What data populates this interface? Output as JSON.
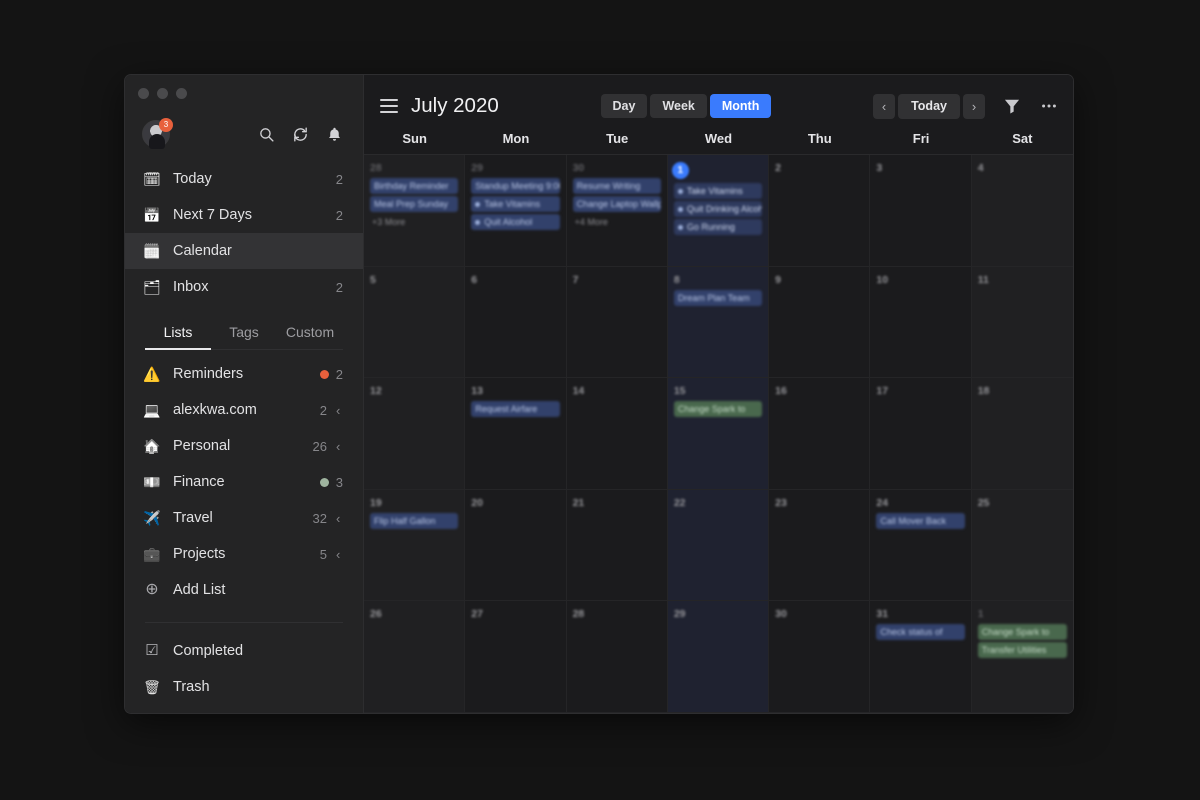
{
  "window": {
    "traffic_lights": [
      "close",
      "minimize",
      "zoom"
    ]
  },
  "sidebar": {
    "avatar_badge": "3",
    "header_icons": [
      "search-icon",
      "sync-icon",
      "bell-icon"
    ],
    "nav": [
      {
        "icon": "calendar-day",
        "label": "Today",
        "count": "2"
      },
      {
        "icon": "calendar-week",
        "label": "Next 7 Days",
        "count": "2"
      },
      {
        "icon": "calendar",
        "label": "Calendar",
        "count": "",
        "active": true
      },
      {
        "icon": "inbox",
        "label": "Inbox",
        "count": "2"
      }
    ],
    "tabs": [
      {
        "label": "Lists",
        "active": true
      },
      {
        "label": "Tags",
        "active": false
      },
      {
        "label": "Custom",
        "active": false
      }
    ],
    "lists": [
      {
        "icon": "⚠️",
        "label": "Reminders",
        "count": "2",
        "dot": "#e8603c",
        "chevron": ""
      },
      {
        "icon": "💻",
        "label": "alexkwa.com",
        "count": "2",
        "dot": "",
        "chevron": "‹"
      },
      {
        "icon": "🏠",
        "label": "Personal",
        "count": "26",
        "dot": "",
        "chevron": "‹"
      },
      {
        "icon": "💵",
        "label": "Finance",
        "count": "3",
        "dot": "#9fb49f",
        "chevron": ""
      },
      {
        "icon": "✈️",
        "label": "Travel",
        "count": "32",
        "dot": "",
        "chevron": "‹"
      },
      {
        "icon": "💼",
        "label": "Projects",
        "count": "5",
        "dot": "",
        "chevron": "‹"
      },
      {
        "icon": "⊕",
        "label": "Add List",
        "count": "",
        "dot": "",
        "chevron": ""
      }
    ],
    "footer": [
      {
        "icon": "☑",
        "label": "Completed"
      },
      {
        "icon": "🗑",
        "label": "Trash"
      }
    ]
  },
  "toolbar": {
    "menu_icon": "hamburger-icon",
    "title": "July 2020",
    "views": [
      {
        "label": "Day",
        "active": false
      },
      {
        "label": "Week",
        "active": false
      },
      {
        "label": "Month",
        "active": true
      }
    ],
    "prev_label": "‹",
    "today_label": "Today",
    "next_label": "›",
    "filter_icon": "filter-icon",
    "more_icon": "more-icon",
    "accent_color": "#3a7bfd"
  },
  "calendar": {
    "day_headers": [
      "Sun",
      "Mon",
      "Tue",
      "Wed",
      "Thu",
      "Fri",
      "Sat"
    ],
    "weeks": [
      [
        {
          "day": "28",
          "out": true,
          "weekend": true,
          "events": [
            {
              "text": "Birthday Reminder",
              "style": "blue"
            },
            {
              "text": "Meal Prep Sunday",
              "style": "blue"
            },
            {
              "text": "+3 More",
              "style": "plain"
            }
          ]
        },
        {
          "day": "29",
          "out": true,
          "events": [
            {
              "text": "Standup Meeting 9:00",
              "style": "blue"
            },
            {
              "text": "Take Vitamins",
              "style": "blue",
              "dot": true
            },
            {
              "text": "Quit Alcohol",
              "style": "blue",
              "dot": true
            }
          ]
        },
        {
          "day": "30",
          "out": true,
          "events": [
            {
              "text": "Resume Writing",
              "style": "blue"
            },
            {
              "text": "Change Laptop Wallpaper",
              "style": "blue"
            },
            {
              "text": "+4 More",
              "style": "plain"
            }
          ]
        },
        {
          "day": "1",
          "today": true,
          "todaycol": true,
          "events": [
            {
              "text": "Take Vitamins",
              "style": "dotted",
              "dot": true
            },
            {
              "text": "Quit Drinking Alcohol",
              "style": "dotted",
              "dot": true
            },
            {
              "text": "Go Running",
              "style": "dotted",
              "dot": true
            }
          ]
        },
        {
          "day": "2",
          "events": []
        },
        {
          "day": "3",
          "events": []
        },
        {
          "day": "4",
          "weekend": true,
          "events": []
        }
      ],
      [
        {
          "day": "5",
          "weekend": true,
          "events": []
        },
        {
          "day": "6",
          "events": []
        },
        {
          "day": "7",
          "events": []
        },
        {
          "day": "8",
          "todaycol": true,
          "events": [
            {
              "text": "Dream Plan Team",
              "style": "blue"
            }
          ]
        },
        {
          "day": "9",
          "events": []
        },
        {
          "day": "10",
          "events": []
        },
        {
          "day": "11",
          "weekend": true,
          "events": []
        }
      ],
      [
        {
          "day": "12",
          "weekend": true,
          "events": []
        },
        {
          "day": "13",
          "events": [
            {
              "text": "Request Airfare",
              "style": "blue"
            }
          ]
        },
        {
          "day": "14",
          "events": []
        },
        {
          "day": "15",
          "todaycol": true,
          "events": [
            {
              "text": "Change Spark to",
              "style": "green"
            }
          ]
        },
        {
          "day": "16",
          "events": []
        },
        {
          "day": "17",
          "events": []
        },
        {
          "day": "18",
          "weekend": true,
          "events": []
        }
      ],
      [
        {
          "day": "19",
          "weekend": true,
          "events": [
            {
              "text": "Flip Half Gallon",
              "style": "blue"
            }
          ]
        },
        {
          "day": "20",
          "events": []
        },
        {
          "day": "21",
          "events": []
        },
        {
          "day": "22",
          "todaycol": true,
          "events": []
        },
        {
          "day": "23",
          "events": []
        },
        {
          "day": "24",
          "events": [
            {
              "text": "Call Mover Back",
              "style": "blue"
            }
          ]
        },
        {
          "day": "25",
          "weekend": true,
          "events": []
        }
      ],
      [
        {
          "day": "26",
          "weekend": true,
          "events": []
        },
        {
          "day": "27",
          "events": []
        },
        {
          "day": "28",
          "events": []
        },
        {
          "day": "29",
          "todaycol": true,
          "events": []
        },
        {
          "day": "30",
          "events": []
        },
        {
          "day": "31",
          "events": [
            {
              "text": "Check status of",
              "style": "blue"
            }
          ]
        },
        {
          "day": "1",
          "out": true,
          "weekend": true,
          "events": [
            {
              "text": "Change Spark to",
              "style": "green"
            },
            {
              "text": "Transfer Utilities",
              "style": "green"
            }
          ]
        }
      ]
    ]
  }
}
